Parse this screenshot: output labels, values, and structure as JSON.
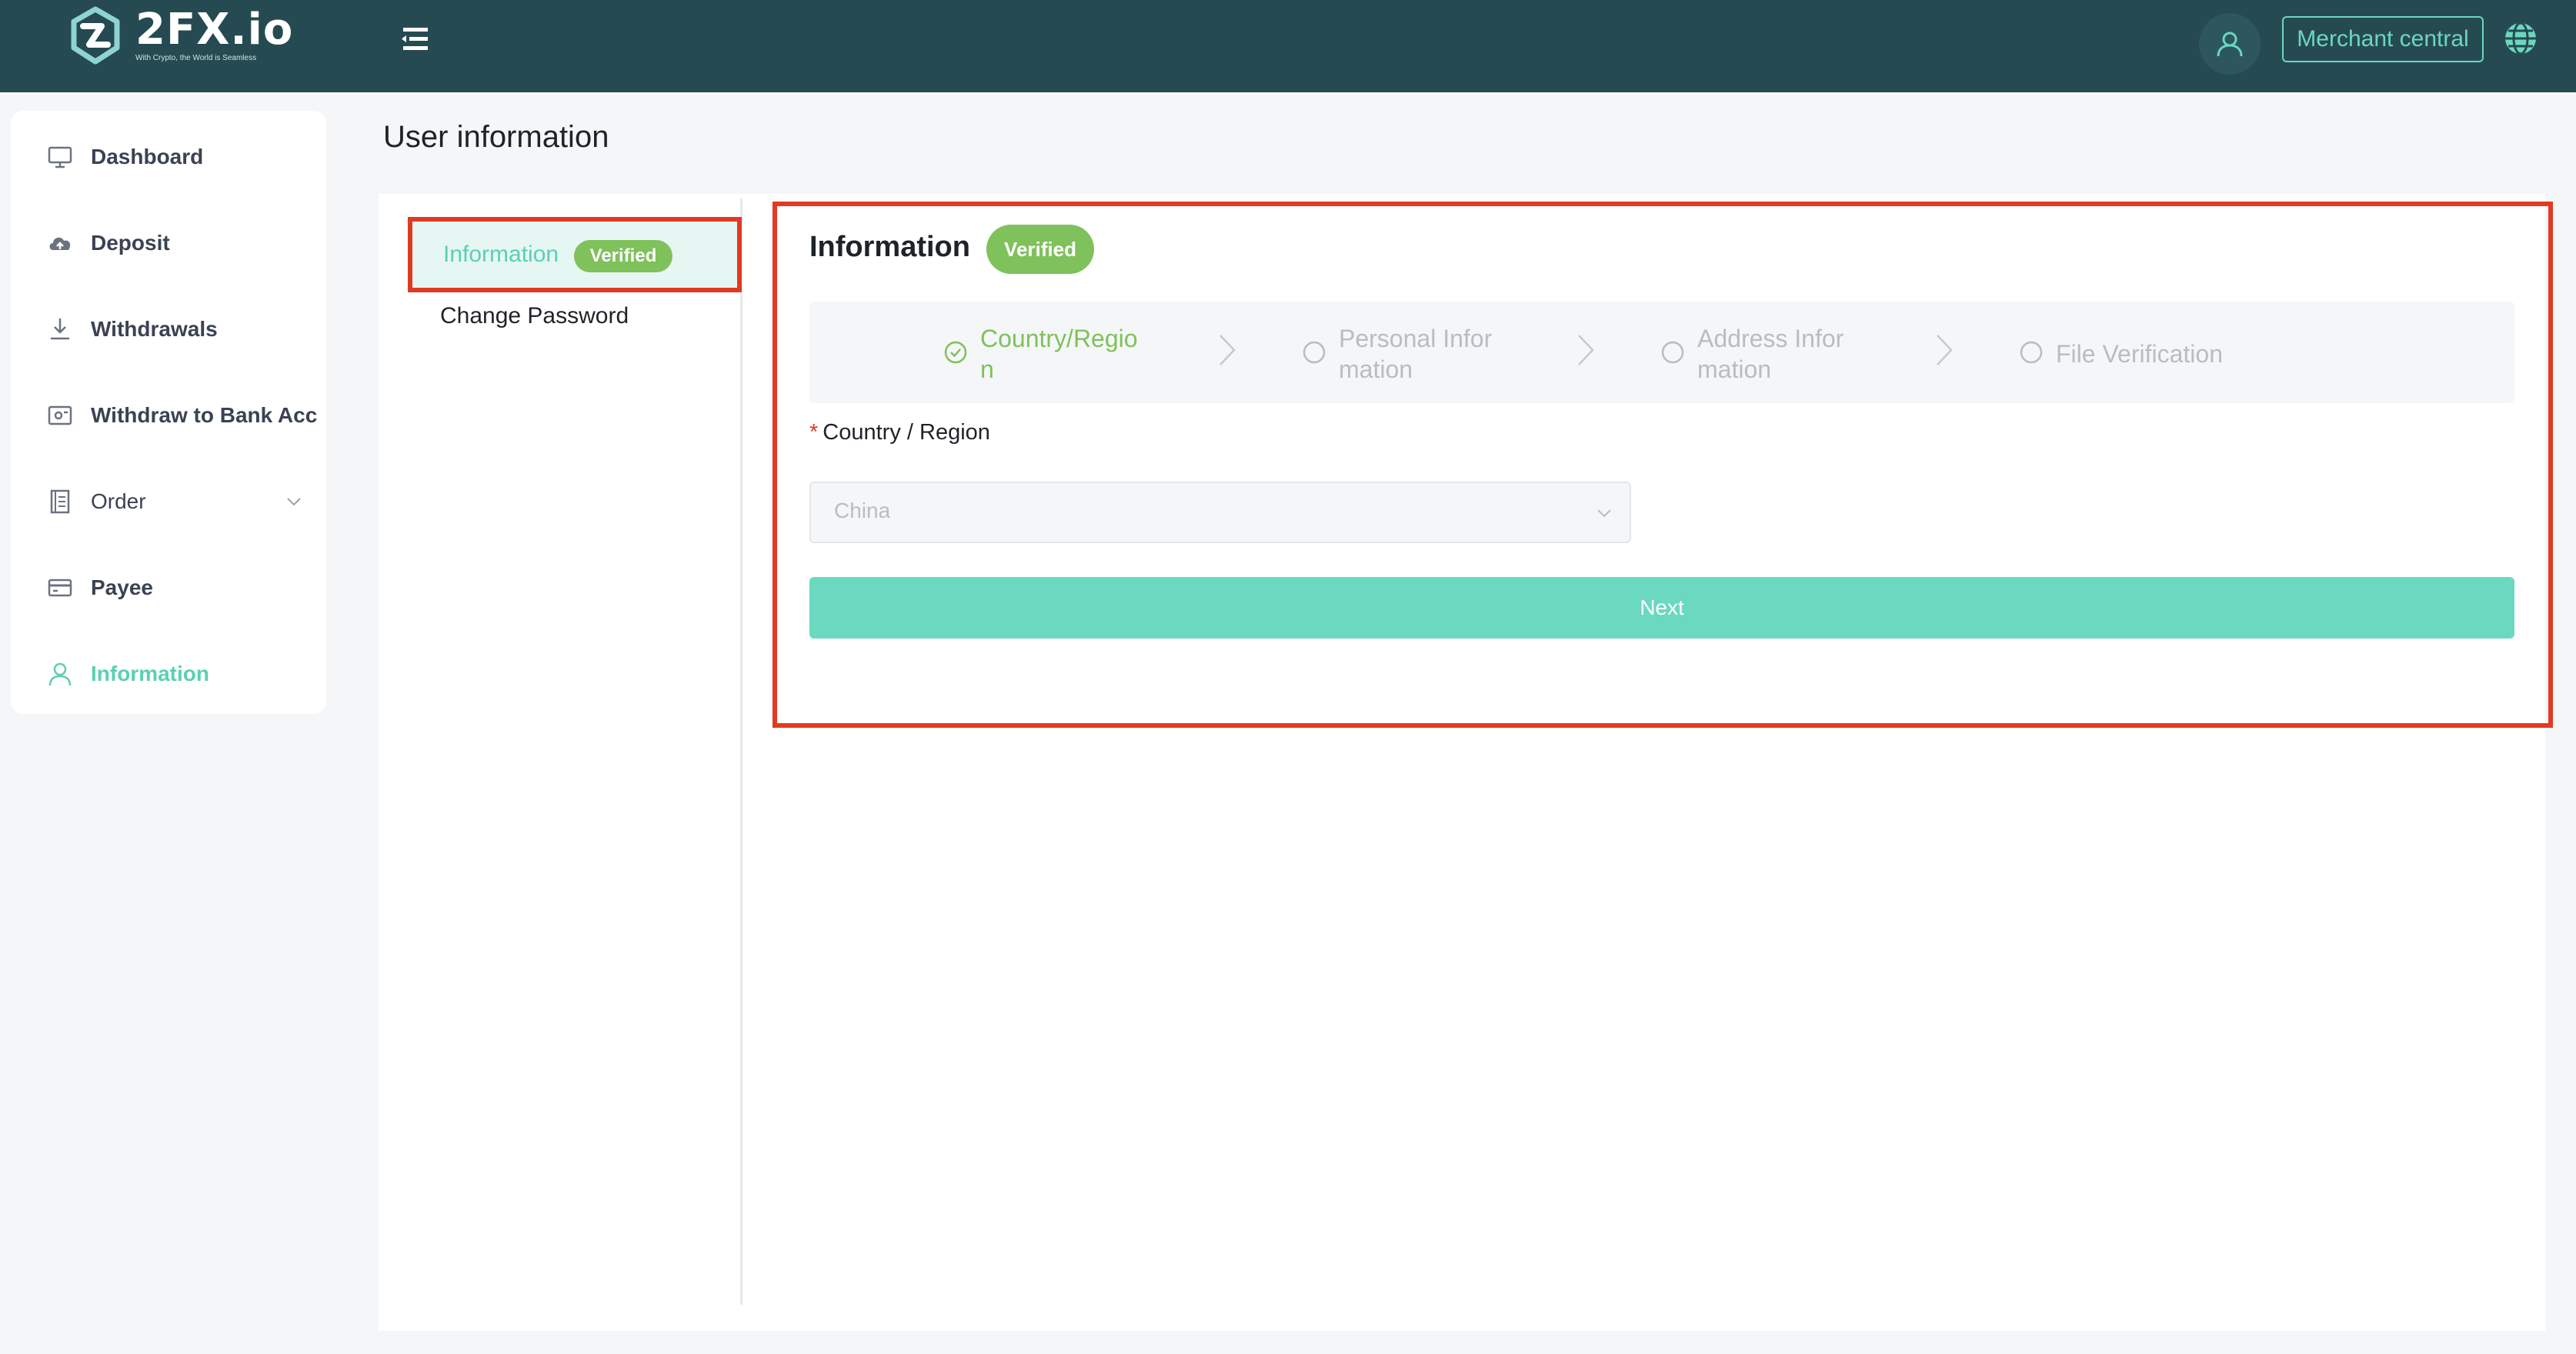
{
  "app": {
    "logo_text": "2FX.io",
    "logo_tagline": "With Crypto, the World is Seamless",
    "brand_color": "#264a52",
    "accent_color": "#6ad9bf"
  },
  "header": {
    "menu_icon": "hamburger-icon",
    "user_icon": "user-icon",
    "merchant_label": "Merchant central",
    "language_icon": "globe-icon"
  },
  "sidebar": {
    "items": [
      {
        "label": "Dashboard",
        "icon": "monitor-icon"
      },
      {
        "label": "Deposit",
        "icon": "cloud-upload-icon"
      },
      {
        "label": "Withdrawals",
        "icon": "download-icon"
      },
      {
        "label": "Withdraw to Bank Acc",
        "icon": "bank-card-icon"
      },
      {
        "label": "Order",
        "icon": "document-icon"
      },
      {
        "label": "Payee",
        "icon": "credit-card-icon"
      },
      {
        "label": "Information",
        "icon": "user-icon"
      }
    ],
    "active": "Information"
  },
  "page": {
    "title": "User information"
  },
  "tabs": {
    "information_label": "Information",
    "information_badge": "Verified",
    "change_password_label": "Change Password"
  },
  "form": {
    "title": "Information",
    "badge": "Verified",
    "steps": [
      {
        "line1": "Country/Regio",
        "line2": "n",
        "status": "done"
      },
      {
        "line1": "Personal Infor",
        "line2": "mation",
        "status": "wait"
      },
      {
        "line1": "Address Infor",
        "line2": "mation",
        "status": "wait"
      },
      {
        "line1": "File Verification",
        "line2": "",
        "status": "wait"
      }
    ],
    "country_label": "Country / Region",
    "required_mark": "*",
    "country_value": "China",
    "next_label": "Next"
  }
}
